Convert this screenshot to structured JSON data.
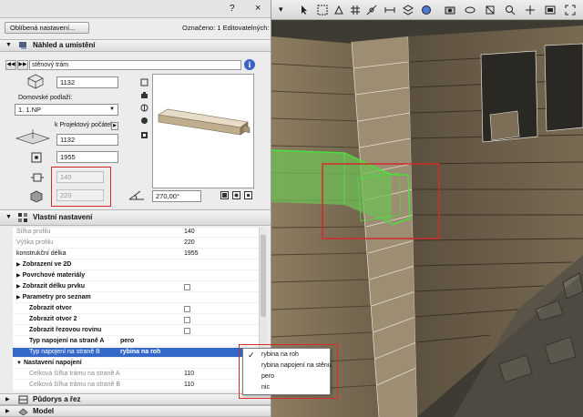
{
  "panel": {
    "favorites_label": "Oblíbená nastavení...",
    "selection_info": "Označeno: 1 Editovatelných: 1",
    "help_glyph": "?",
    "close_glyph": "×"
  },
  "section_preview": {
    "title": "Náhled a umístění"
  },
  "profile": {
    "name": "stěnový trám"
  },
  "geometry": {
    "top_value": "1132",
    "home_story_label": "Domovské podlaží:",
    "home_story_value": "1. 1.NP",
    "project_origin_label": "k Projektový počátek",
    "project_origin_value": "1132",
    "length_value": "1955",
    "width_value": "140",
    "height_value": "220",
    "angle_value": "270,00°"
  },
  "section_custom": {
    "title": "Vlastní nastavení"
  },
  "properties": [
    {
      "name": "Šířka profilu",
      "value": "140",
      "style": "gray"
    },
    {
      "name": "Výška profilu",
      "value": "220",
      "style": "gray"
    },
    {
      "name": "konstrukční délka",
      "value": "1955",
      "style": "normal"
    },
    {
      "name": "Zobrazení ve 2D",
      "value": "",
      "style": "group"
    },
    {
      "name": "Povrchové materiály",
      "value": "",
      "style": "group"
    },
    {
      "name": "Zobrazit délku prvku",
      "value": "",
      "style": "group",
      "checkbox": true
    },
    {
      "name": "Parametry pro seznam",
      "value": "",
      "style": "group"
    },
    {
      "name": "Zobrazit otvor",
      "value": "",
      "style": "bold",
      "checkbox": true
    },
    {
      "name": "Zobrazit otvor 2",
      "value": "",
      "style": "bold",
      "checkbox": true
    },
    {
      "name": "Zobrazit řezovou rovinu",
      "value": "",
      "style": "bold",
      "checkbox": true
    },
    {
      "name": "Typ napojení na straně A",
      "value": "pero",
      "style": "bold"
    },
    {
      "name": "Typ napojení na straně B",
      "value": "rybina na roh",
      "style": "selected"
    },
    {
      "name": "Nastavení napojení",
      "value": "",
      "style": "group"
    },
    {
      "name": "Celková šířka trámu na straně A",
      "value": "110",
      "style": "gray"
    },
    {
      "name": "Celková šířka trámu na straně B",
      "value": "110",
      "style": "gray"
    }
  ],
  "dropdown": {
    "options": [
      "rybina na roh",
      "rybina napojení na stěnu",
      "pero",
      "nic"
    ],
    "selected_index": 0
  },
  "sections_bottom": {
    "floorplan": "Půdorys a řez",
    "model": "Model"
  },
  "colors": {
    "selection_blue": "#3469c9",
    "highlight_red": "#d42a2a",
    "beam_green": "#5fc24a",
    "wood": "#7a6a4e"
  }
}
